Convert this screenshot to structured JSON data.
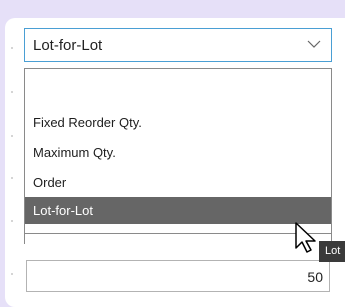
{
  "dropdown": {
    "selected_value": "Lot-for-Lot",
    "options": [
      {
        "label": ""
      },
      {
        "label": "Fixed Reorder Qty."
      },
      {
        "label": "Maximum Qty."
      },
      {
        "label": "Order"
      },
      {
        "label": "Lot-for-Lot",
        "selected": true
      }
    ]
  },
  "quantity_field": {
    "value": "50"
  },
  "tooltip": {
    "text": "Lot"
  },
  "colors": {
    "background": "#e6e0f8",
    "focus_border": "#4a9fd4",
    "selected_item": "#666666"
  },
  "icons": {
    "chevron": "chevron-down-icon",
    "cursor": "mouse-pointer-icon"
  }
}
